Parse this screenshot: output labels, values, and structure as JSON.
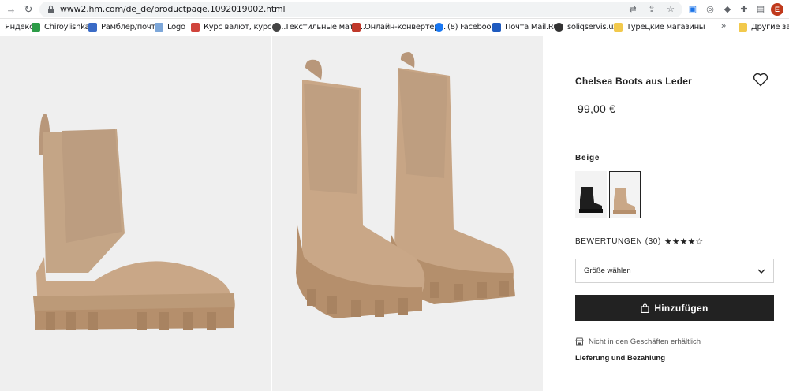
{
  "browser": {
    "url": "www2.hm.com/de_de/productpage.1092019002.html",
    "profile_initial": "E",
    "bookmarks": [
      {
        "label": "Яндекс",
        "color": "#ffffff"
      },
      {
        "label": "Chiroylishka",
        "color": "#2d9c48"
      },
      {
        "label": "Рамблер/почта",
        "color": "#3a6bc6"
      },
      {
        "label": "Logo",
        "color": "#7da7d9"
      },
      {
        "label": "Курс валют, курс д...",
        "color": "#d0443c"
      },
      {
        "label": "Текстильные мате...",
        "color": "#444444"
      },
      {
        "label": "Онлайн-конвертер...",
        "color": "#c0392b"
      },
      {
        "label": "(8) Facebook",
        "color": "#1877f2"
      },
      {
        "label": "Почта Mail.Ru",
        "color": "#1f5bbf"
      },
      {
        "label": "soliqservis.uz",
        "color": "#333333"
      },
      {
        "label": "Турецкие магазины",
        "color": "#f2c94c"
      },
      {
        "label": "Другие закла",
        "color": "#f2c94c"
      }
    ]
  },
  "product": {
    "title": "Chelsea Boots aus Leder",
    "price": "99,00 €",
    "color_label": "Beige",
    "reviews_label": "BEWERTUNGEN (30)",
    "rating": 4,
    "rating_max": 5,
    "stars_text": "★★★★☆",
    "size_placeholder": "Größe wählen",
    "add_button": "Hinzufügen",
    "store_note": "Nicht in den Geschäften erhältlich",
    "delivery_link": "Lieferung und Bezahlung"
  },
  "colors": {
    "boot": "#c9a787",
    "button": "#222222"
  }
}
